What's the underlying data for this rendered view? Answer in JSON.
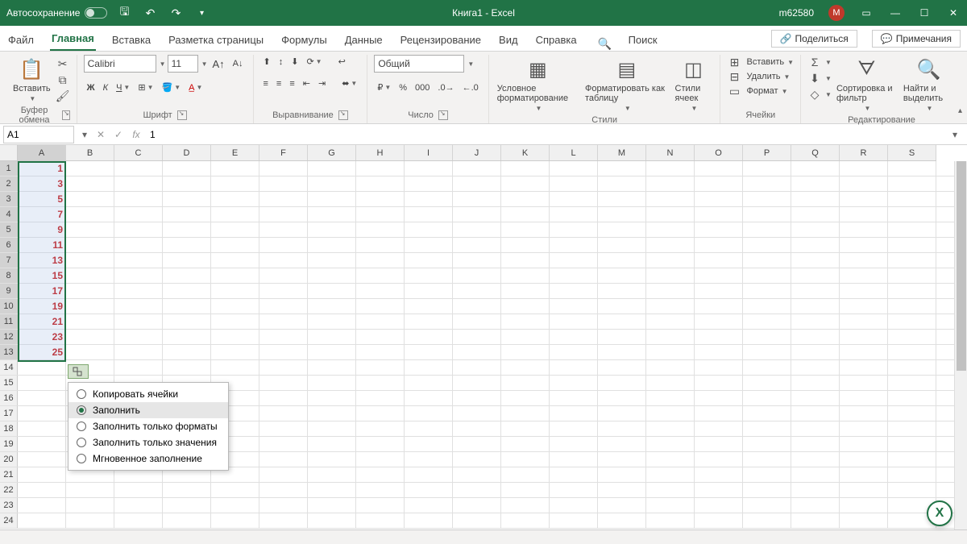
{
  "title": {
    "autosave": "Автосохранение",
    "doc": "Книга1  -  Excel",
    "user": "m62580",
    "avatar": "M"
  },
  "tabs": {
    "file": "Файл",
    "home": "Главная",
    "insert": "Вставка",
    "layout": "Разметка страницы",
    "formulas": "Формулы",
    "data": "Данные",
    "review": "Рецензирование",
    "view": "Вид",
    "help": "Справка",
    "search": "Поиск"
  },
  "share": {
    "share": "Поделиться",
    "comments": "Примечания"
  },
  "ribbon": {
    "clipboard": {
      "paste": "Вставить",
      "label": "Буфер обмена"
    },
    "font": {
      "name": "Calibri",
      "size": "11",
      "label": "Шрифт"
    },
    "align": {
      "label": "Выравнивание"
    },
    "number": {
      "format": "Общий",
      "label": "Число"
    },
    "styles": {
      "cond": "Условное форматирование",
      "table": "Форматировать как таблицу",
      "cell": "Стили ячеек",
      "label": "Стили"
    },
    "cells": {
      "insert": "Вставить",
      "delete": "Удалить",
      "format": "Формат",
      "label": "Ячейки"
    },
    "editing": {
      "sort": "Сортировка и фильтр",
      "find": "Найти и выделить",
      "label": "Редактирование"
    }
  },
  "namebox": "A1",
  "formula": "1",
  "columns": [
    "A",
    "B",
    "C",
    "D",
    "E",
    "F",
    "G",
    "H",
    "I",
    "J",
    "K",
    "L",
    "M",
    "N",
    "O",
    "P",
    "Q",
    "R",
    "S"
  ],
  "grid": {
    "colA": [
      "1",
      "3",
      "5",
      "7",
      "9",
      "11",
      "13",
      "15",
      "17",
      "19",
      "21",
      "23",
      "25"
    ],
    "rows": 24
  },
  "autofill_menu": {
    "copy": "Копировать ячейки",
    "fill": "Заполнить",
    "fmtonly": "Заполнить только форматы",
    "valonly": "Заполнить только значения",
    "flash": "Мгновенное заполнение"
  }
}
